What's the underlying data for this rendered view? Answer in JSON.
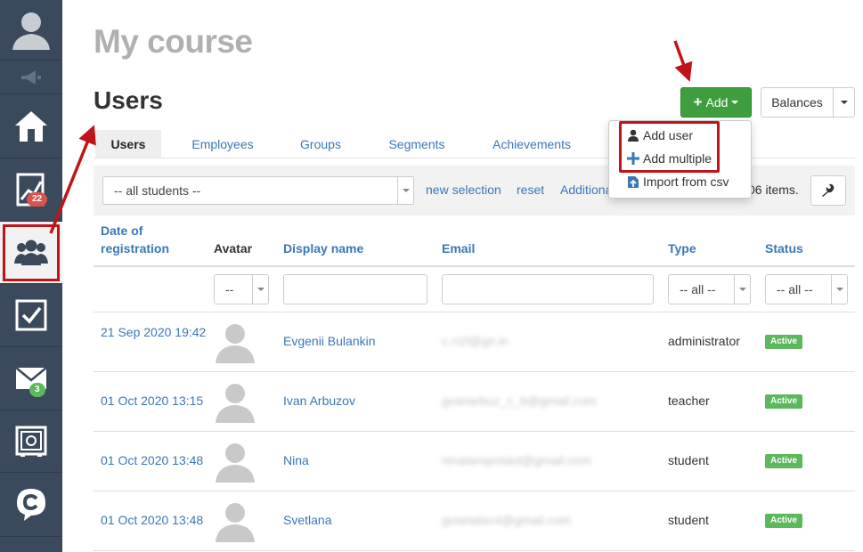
{
  "course_title": "My course",
  "page_title": "Users",
  "header_buttons": {
    "add": "Add",
    "balances": "Balances"
  },
  "sidebar": {
    "items": [
      {
        "icon": "user-avatar-icon"
      },
      {
        "icon": "megaphone-icon"
      },
      {
        "icon": "home-icon"
      },
      {
        "icon": "stats-chart-icon",
        "badge": "22"
      },
      {
        "icon": "users-group-icon",
        "active": true
      },
      {
        "icon": "checkbox-icon"
      },
      {
        "icon": "mail-icon",
        "badge": "3"
      },
      {
        "icon": "safe-icon"
      },
      {
        "icon": "chat-logo-icon"
      }
    ],
    "badge_red": "#d9534f",
    "badge_green": "#5cb85c"
  },
  "add_menu": {
    "items": [
      {
        "icon": "person-icon",
        "label": "Add user"
      },
      {
        "icon": "plus-icon",
        "label": "Add multiple"
      },
      {
        "icon": "csv-import-icon",
        "label": "Import from csv"
      }
    ]
  },
  "tabs": [
    "Users",
    "Employees",
    "Groups",
    "Segments",
    "Achievements"
  ],
  "filter": {
    "students_select": "-- all students --",
    "links": {
      "new_selection": "new selection",
      "reset": "reset",
      "additional": "Additiona"
    },
    "items_count": "06 items."
  },
  "table": {
    "headers": {
      "date_line1": "Date of",
      "date_line2": "registration",
      "avatar": "Avatar",
      "display_name": "Display name",
      "email": "Email",
      "type": "Type",
      "status": "Status"
    },
    "filters": {
      "avatar": "--",
      "type": "-- all --",
      "status": "-- all --"
    },
    "rows": [
      {
        "date": "21 Sep 2020 19:42",
        "name": "Evgenii Bulankin",
        "email": "c.n1f@gn.in",
        "type": "administrator",
        "status": "Active"
      },
      {
        "date": "01 Oct 2020 13:15",
        "name": "Ivan Arbuzov",
        "email": "gvanarbuz_c_b@gmail.com",
        "type": "teacher",
        "status": "Active"
      },
      {
        "date": "01 Oct 2020 13:48",
        "name": "Nina",
        "email": "ninalampniskd@gmail.com",
        "type": "student",
        "status": "Active"
      },
      {
        "date": "01 Oct 2020 13:48",
        "name": "Svetlana",
        "email": "gvsetatsc4@gmail.com",
        "type": "student",
        "status": "Active"
      }
    ]
  },
  "colors": {
    "sidebar_bg": "#3a4a5c",
    "link_blue": "#3a77b8",
    "add_green": "#3e9e3e",
    "status_green": "#5cb85c",
    "annotation_red": "#c0141a"
  }
}
